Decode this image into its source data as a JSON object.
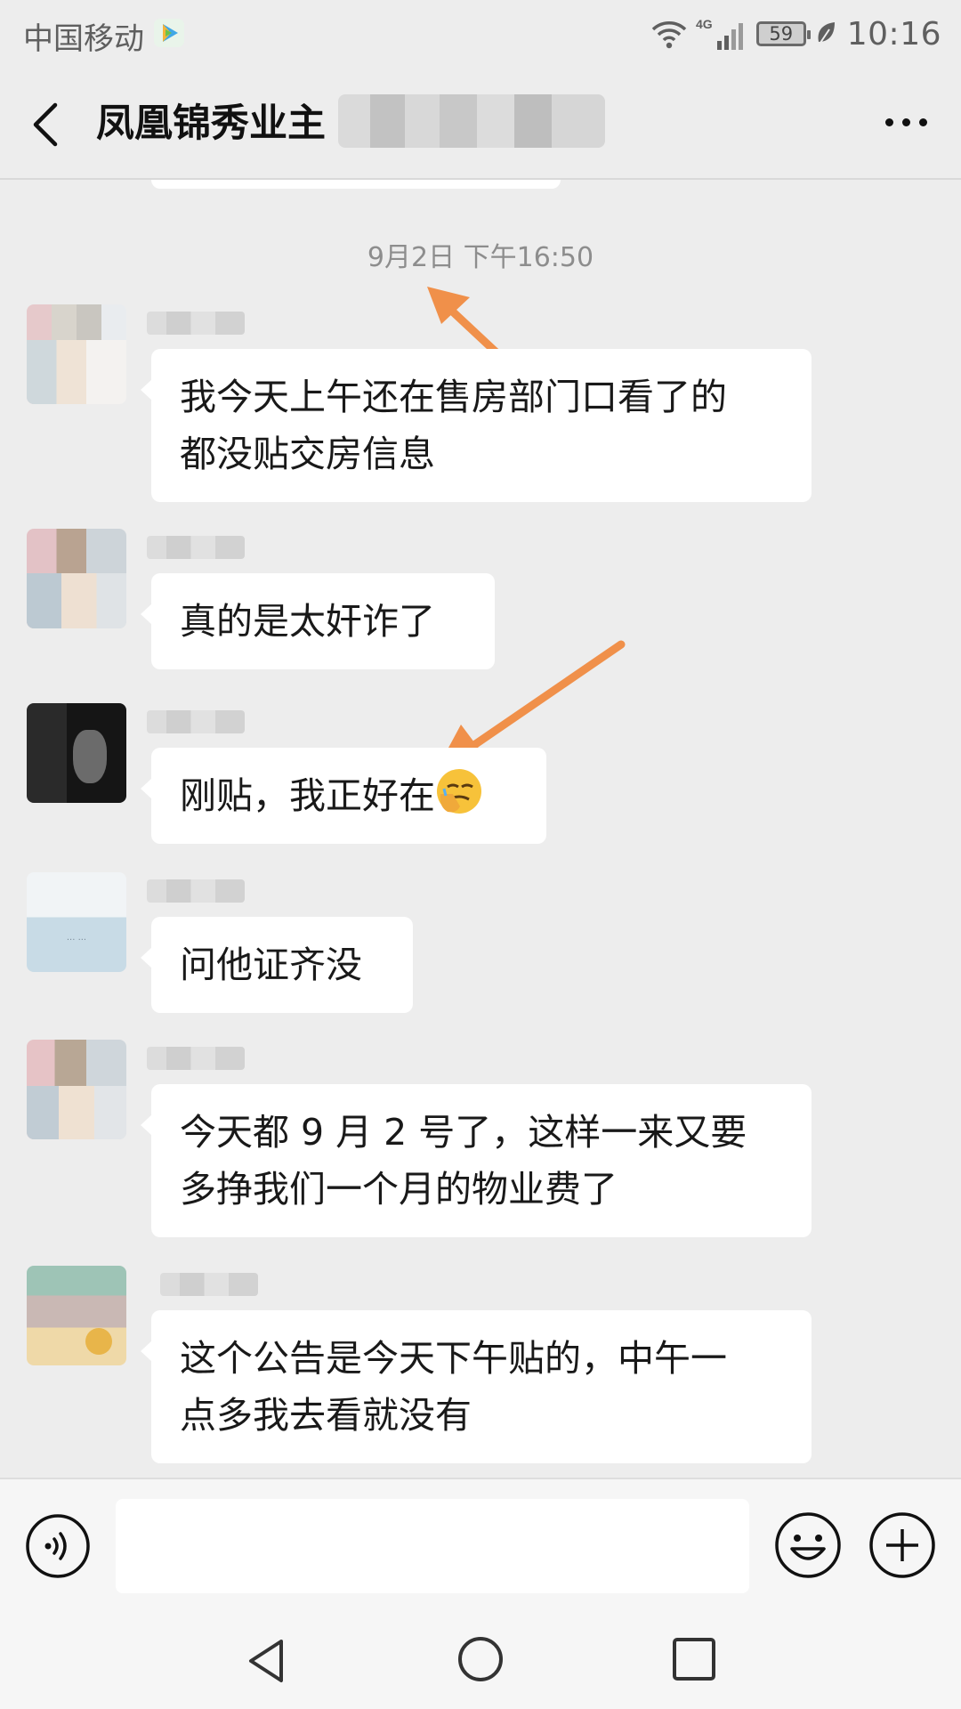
{
  "status_bar": {
    "carrier": "中国移动",
    "network": "4G",
    "battery": "59",
    "time": "10:16"
  },
  "header": {
    "title": "凤凰锦秀业主"
  },
  "chat": {
    "timestamp": "9月2日 下午16:50",
    "messages": [
      {
        "text": "我今天上午还在售房部门口看了的\n都没贴交房信息"
      },
      {
        "text": "真的是太奸诈了"
      },
      {
        "text": "刚贴，我正好在",
        "emoji": "facepalm-crying-emoji"
      },
      {
        "text": "问他证齐没"
      },
      {
        "text": "今天都 9 月 2 号了，这样一来又要\n多挣我们一个月的物业费了"
      },
      {
        "text": "这个公告是今天下午贴的，中午一\n点多我去看就没有"
      }
    ]
  },
  "annotation_color": "#f0904a",
  "input_bar": {
    "placeholder": ""
  },
  "icons": [
    "back-arrow-icon",
    "more-icon",
    "voice-icon",
    "emoji-icon",
    "plus-icon",
    "nav-back-icon",
    "nav-home-icon",
    "nav-recent-icon"
  ]
}
